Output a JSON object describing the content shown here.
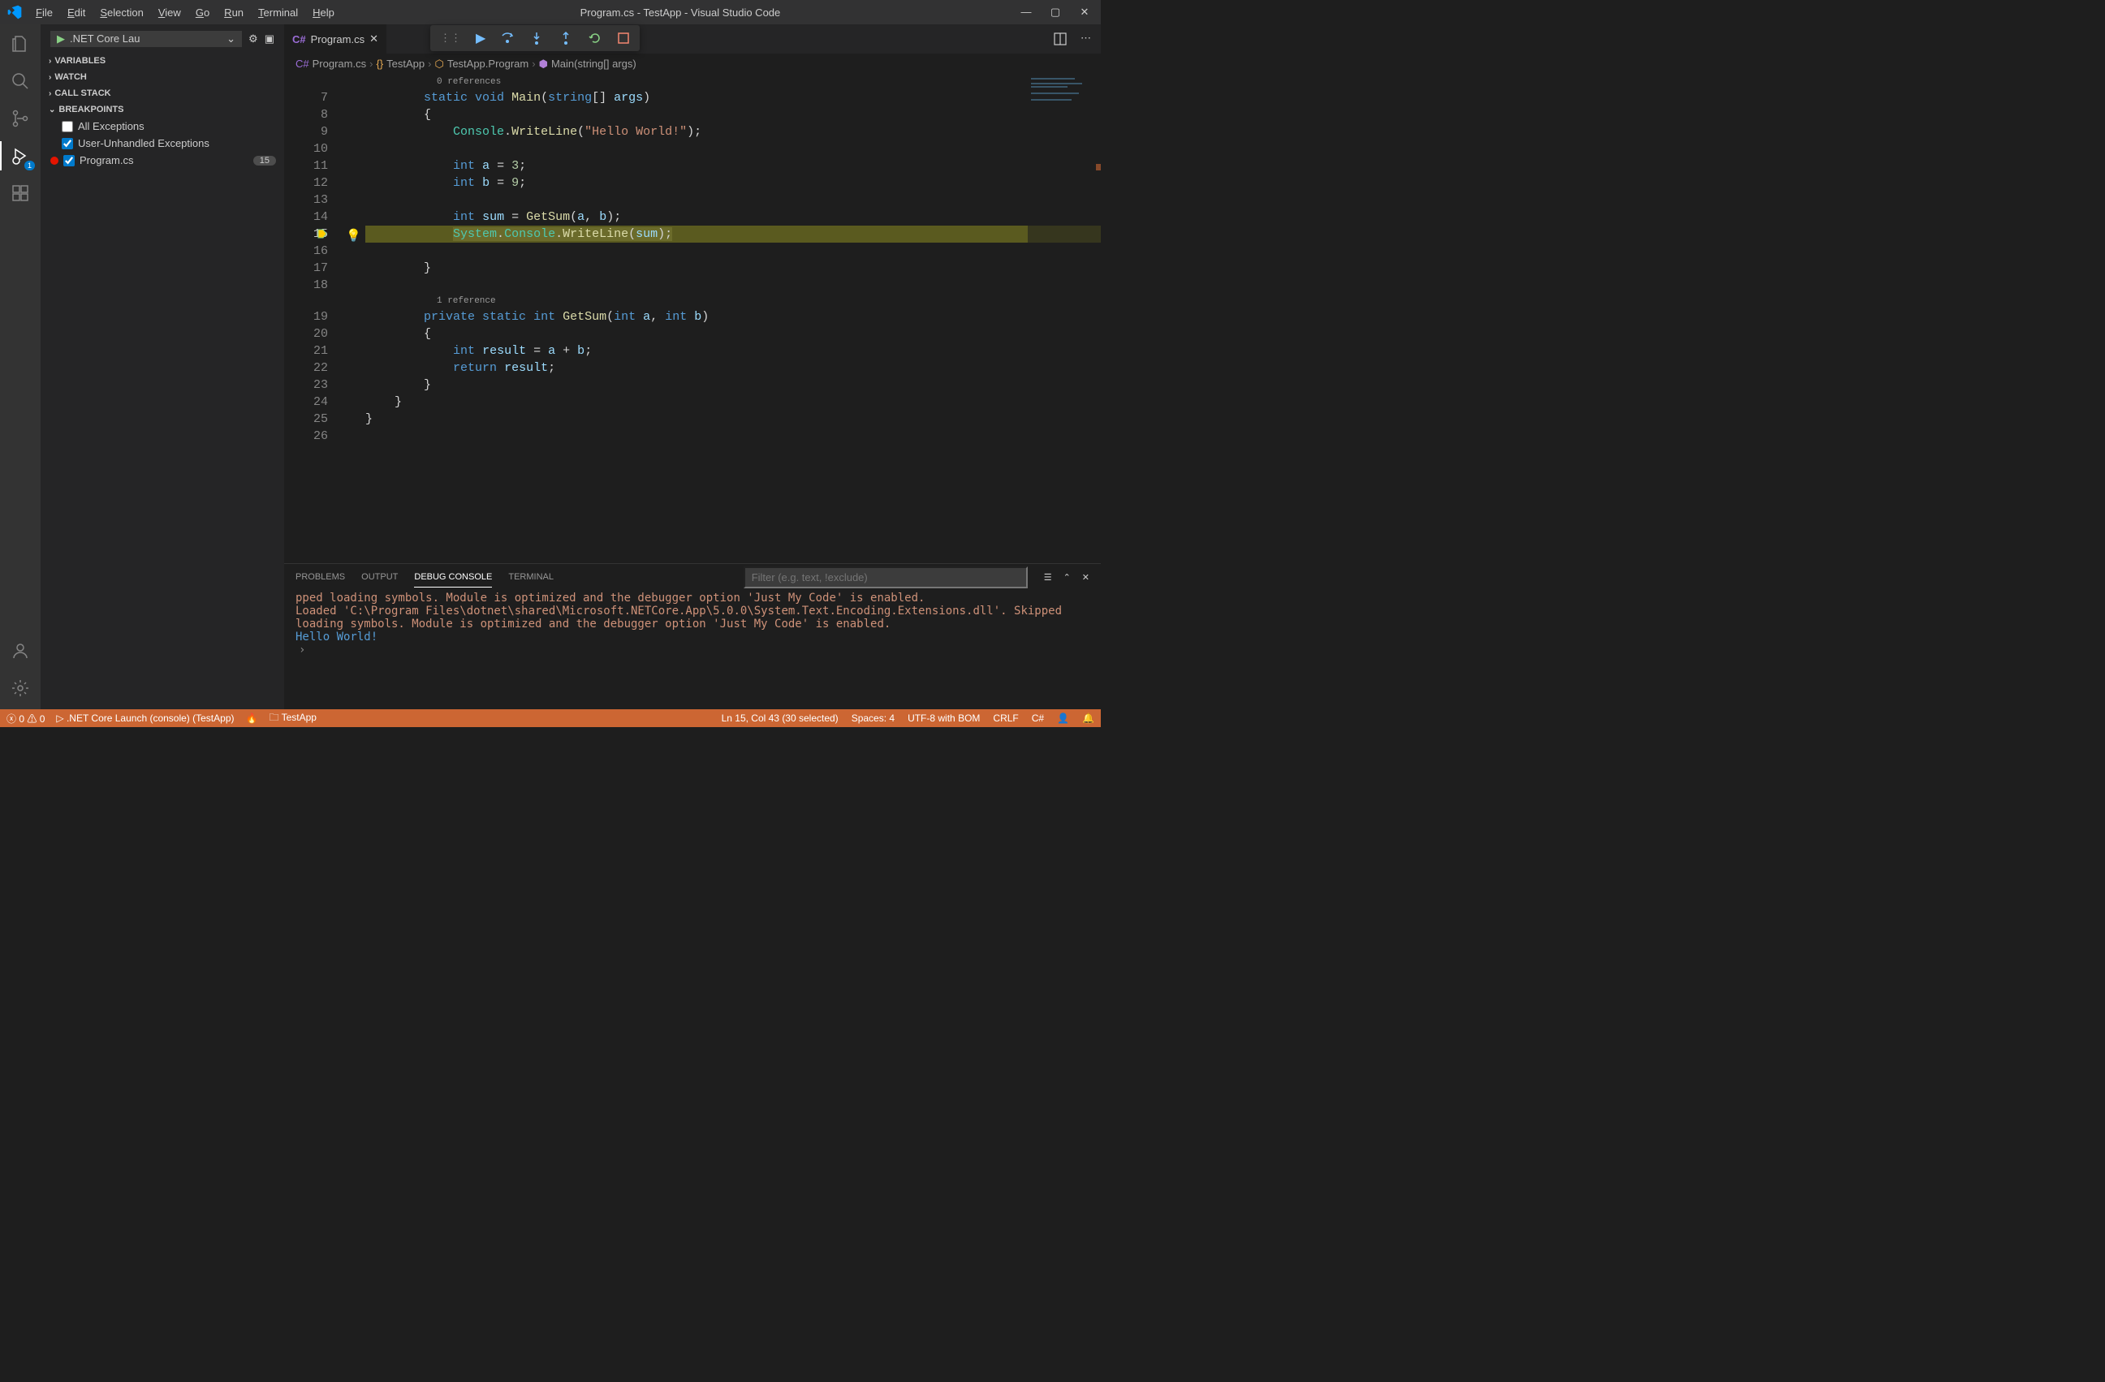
{
  "title": "Program.cs - TestApp - Visual Studio Code",
  "menu": [
    "File",
    "Edit",
    "Selection",
    "View",
    "Go",
    "Run",
    "Terminal",
    "Help"
  ],
  "launch_config": ".NET Core Lau",
  "activity_badge": "1",
  "sidebar": {
    "sections": {
      "variables": "VARIABLES",
      "watch": "WATCH",
      "callstack": "CALL STACK",
      "breakpoints": "BREAKPOINTS"
    },
    "bp_all": "All Exceptions",
    "bp_user": "User-Unhandled Exceptions",
    "bp_file": "Program.cs",
    "bp_line_badge": "15"
  },
  "tab": {
    "file": "Program.cs"
  },
  "breadcrumb": {
    "file": "Program.cs",
    "ns": "TestApp",
    "cls": "TestApp.Program",
    "meth": "Main(string[] args)"
  },
  "codelens": {
    "refs0": "0 references",
    "refs1": "1 reference"
  },
  "code": {
    "l7a": "static",
    "l7b": "void",
    "l7c": "Main",
    "l7d": "string",
    "l7e": "args",
    "l9a": "Console",
    "l9b": "WriteLine",
    "l9c": "\"Hello World!\"",
    "l11a": "int",
    "l11b": "a",
    "l11c": "3",
    "l12a": "int",
    "l12b": "b",
    "l12c": "9",
    "l14a": "int",
    "l14b": "sum",
    "l14c": "GetSum",
    "l14d": "a",
    "l14e": "b",
    "l15a": "System",
    "l15b": "Console",
    "l15c": "WriteLine",
    "l15d": "sum",
    "l19a": "private",
    "l19b": "static",
    "l19c": "int",
    "l19d": "GetSum",
    "l19e": "int",
    "l19f": "a",
    "l19g": "int",
    "l19h": "b",
    "l21a": "int",
    "l21b": "result",
    "l21c": "a",
    "l21d": "b",
    "l22a": "return",
    "l22b": "result"
  },
  "lines": [
    "7",
    "8",
    "9",
    "10",
    "11",
    "12",
    "13",
    "14",
    "15",
    "16",
    "17",
    "18",
    "",
    "19",
    "20",
    "21",
    "22",
    "23",
    "24",
    "25",
    "26"
  ],
  "panel": {
    "tabs": {
      "problems": "PROBLEMS",
      "output": "OUTPUT",
      "debug": "DEBUG CONSOLE",
      "terminal": "TERMINAL"
    },
    "filter_placeholder": "Filter (e.g. text, !exclude)"
  },
  "console": {
    "line1": "pped loading symbols. Module is optimized and the debugger option 'Just My Code' is enabled.",
    "line2": "Loaded 'C:\\Program Files\\dotnet\\shared\\Microsoft.NETCore.App\\5.0.0\\System.Text.Encoding.Extensions.dll'. Skipped loading symbols. Module is optimized and the debugger option 'Just My Code' is enabled.",
    "line3": "Hello World!"
  },
  "status": {
    "errors": "0",
    "warnings": "0",
    "launch": ".NET Core Launch (console) (TestApp)",
    "folder": "TestApp",
    "cursor": "Ln 15, Col 43 (30 selected)",
    "spaces": "Spaces: 4",
    "encoding": "UTF-8 with BOM",
    "eol": "CRLF",
    "lang": "C#"
  }
}
